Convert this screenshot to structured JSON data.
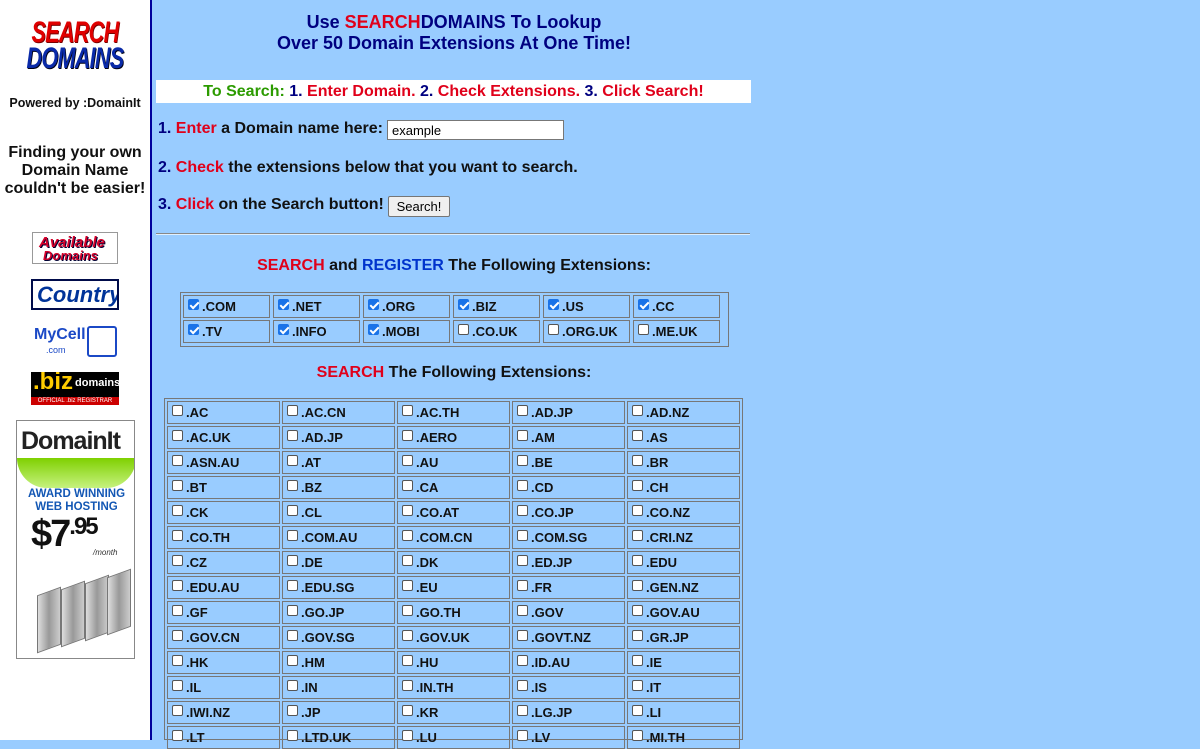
{
  "sidebar": {
    "logo_top": "SEARCH",
    "logo_bottom": "DOMAINS",
    "powered_by": "Powered by :DomainIt",
    "finding_text": "Finding your own Domain Name couldn't be easier!",
    "banners": {
      "available_line1": "Available",
      "available_line2": "Domains",
      "country": "Country",
      "mycell": "MyCell",
      "mycell_com": ".com",
      "biz_big": ".biz",
      "biz_small": "domains",
      "biz_strip": "OFFICIAL .biz REGISTRAR",
      "domainit_logo": "DomainIt",
      "domainit_award": "AWARD WINNING WEB HOSTING",
      "domainit_price_dollars": "$7",
      "domainit_price_cents": ".95",
      "domainit_month": "/month"
    }
  },
  "header": {
    "line1_use": "Use",
    "line1_search": "SEARCH",
    "line1_domains": "DOMAINS",
    "line1_tail": "To Lookup",
    "line2": "Over 50 Domain Extensions At One Time!"
  },
  "instructions": {
    "to_search": "To Search:",
    "n1": "1.",
    "s1": "Enter Domain.",
    "n2": "2.",
    "s2": "Check Extensions.",
    "n3": "3.",
    "s3": "Click Search!"
  },
  "steps": {
    "step1_num": "1.",
    "step1_verb": "Enter",
    "step1_rest": "a Domain name here:",
    "step2_num": "2.",
    "step2_verb": "Check",
    "step2_rest": "the extensions below that you want to search.",
    "step3_num": "3.",
    "step3_verb": "Click",
    "step3_rest": "on the Search button!"
  },
  "domain_input": {
    "value": "example"
  },
  "search_button": {
    "label": "Search!"
  },
  "section_register": {
    "search_word": "SEARCH",
    "and_word": "and",
    "register_word": "REGISTER",
    "tail": "The Following Extensions:",
    "extensions": [
      {
        "label": ".COM",
        "checked": true
      },
      {
        "label": ".NET",
        "checked": true
      },
      {
        "label": ".ORG",
        "checked": true
      },
      {
        "label": ".BIZ",
        "checked": true
      },
      {
        "label": ".US",
        "checked": true
      },
      {
        "label": ".CC",
        "checked": true
      },
      {
        "label": ".TV",
        "checked": true
      },
      {
        "label": ".INFO",
        "checked": true
      },
      {
        "label": ".MOBI",
        "checked": true
      },
      {
        "label": ".CO.UK",
        "checked": false
      },
      {
        "label": ".ORG.UK",
        "checked": false
      },
      {
        "label": ".ME.UK",
        "checked": false
      }
    ]
  },
  "section_search": {
    "search_word": "SEARCH",
    "tail": "The Following Extensions:",
    "extensions": [
      ".AC",
      ".AC.CN",
      ".AC.TH",
      ".AD.JP",
      ".AD.NZ",
      ".AC.UK",
      ".AD.JP",
      ".AERO",
      ".AM",
      ".AS",
      ".ASN.AU",
      ".AT",
      ".AU",
      ".BE",
      ".BR",
      ".BT",
      ".BZ",
      ".CA",
      ".CD",
      ".CH",
      ".CK",
      ".CL",
      ".CO.AT",
      ".CO.JP",
      ".CO.NZ",
      ".CO.TH",
      ".COM.AU",
      ".COM.CN",
      ".COM.SG",
      ".CRI.NZ",
      ".CZ",
      ".DE",
      ".DK",
      ".ED.JP",
      ".EDU",
      ".EDU.AU",
      ".EDU.SG",
      ".EU",
      ".FR",
      ".GEN.NZ",
      ".GF",
      ".GO.JP",
      ".GO.TH",
      ".GOV",
      ".GOV.AU",
      ".GOV.CN",
      ".GOV.SG",
      ".GOV.UK",
      ".GOVT.NZ",
      ".GR.JP",
      ".HK",
      ".HM",
      ".HU",
      ".ID.AU",
      ".IE",
      ".IL",
      ".IN",
      ".IN.TH",
      ".IS",
      ".IT",
      ".IWI.NZ",
      ".JP",
      ".KR",
      ".LG.JP",
      ".LI",
      ".LT",
      ".LTD.UK",
      ".LU",
      ".LV",
      ".MI.TH"
    ]
  }
}
